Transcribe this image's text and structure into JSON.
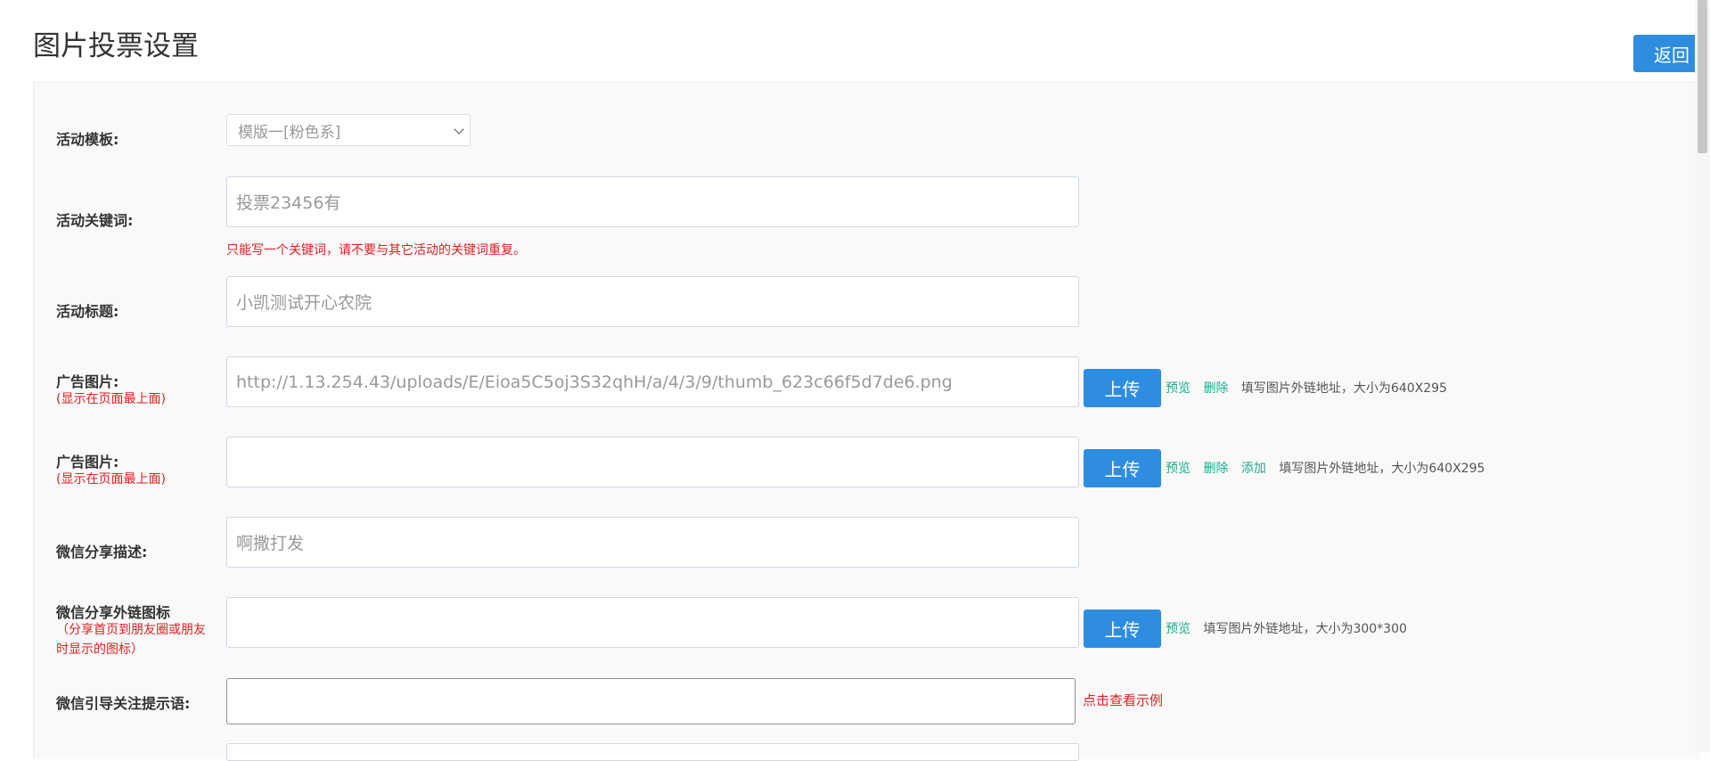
{
  "page_title": "图片投票设置",
  "back_label": "返回",
  "template": {
    "label": "活动模板:",
    "value": "模版一[粉色系]"
  },
  "keyword": {
    "label": "活动关键词:",
    "placeholder": "投票23456有",
    "hint": "只能写一个关键词，请不要与其它活动的关键词重复。"
  },
  "title": {
    "label": "活动标题:",
    "placeholder": "小凯测试开心农院"
  },
  "ad1": {
    "label": "广告图片:",
    "sublabel": "(显示在页面最上面)",
    "value": "http://1.13.254.43/uploads/E/Eioa5C5oj3S32qhH/a/4/3/9/thumb_623c66f5d7de6.png",
    "upload": "上传",
    "preview": "预览",
    "delete": "删除",
    "note": "填写图片外链地址，大小为640X295"
  },
  "ad2": {
    "label": "广告图片:",
    "sublabel": "(显示在页面最上面)",
    "value": "",
    "upload": "上传",
    "preview": "预览",
    "delete": "删除",
    "add": "添加",
    "note": "填写图片外链地址，大小为640X295"
  },
  "share_desc": {
    "label": "微信分享描述:",
    "placeholder": "啊撒打发"
  },
  "share_icon": {
    "label": "微信分享外链图标",
    "sublabel_line1": "（分享首页到朋友圈或朋友",
    "sublabel_line2": "时显示的图标）",
    "value": "",
    "upload": "上传",
    "preview": "预览",
    "note": "填写图片外链地址，大小为300*300"
  },
  "guide": {
    "label": "微信引导关注提示语:",
    "link": "点击查看示例"
  }
}
